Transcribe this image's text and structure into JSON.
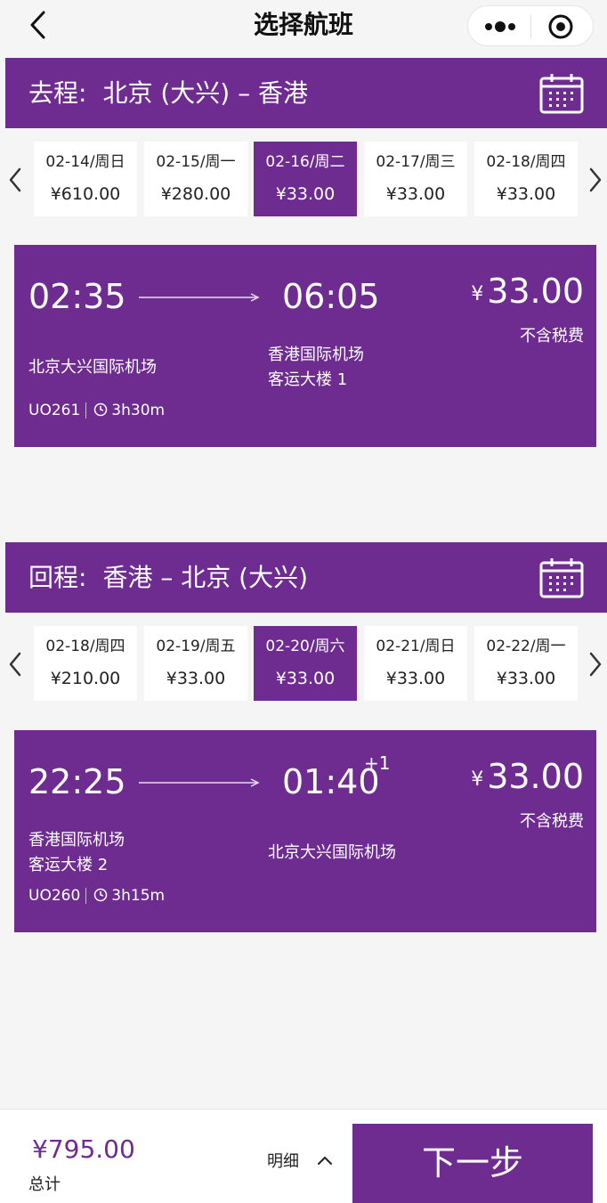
{
  "nav": {
    "title": "选择航班"
  },
  "outbound": {
    "prefix": "去程:",
    "route": "北京 (大兴) – 香港",
    "dates": [
      {
        "date": "02-14/周日",
        "price": "¥610.00",
        "selected": false
      },
      {
        "date": "02-15/周一",
        "price": "¥280.00",
        "selected": false
      },
      {
        "date": "02-16/周二",
        "price": "¥33.00",
        "selected": true
      },
      {
        "date": "02-17/周三",
        "price": "¥33.00",
        "selected": false
      },
      {
        "date": "02-18/周四",
        "price": "¥33.00",
        "selected": false
      }
    ],
    "flight": {
      "dep_time": "02:35",
      "arr_time": "06:05",
      "currency": "¥",
      "price": "33.00",
      "tax_note": "不含税费",
      "dep_airport": "北京大兴国际机场",
      "arr_airport": "香港国际机场",
      "arr_terminal": "客运大楼 1",
      "flight_no": "UO261",
      "duration": "3h30m"
    }
  },
  "return": {
    "prefix": "回程:",
    "route": "香港 – 北京 (大兴)",
    "dates": [
      {
        "date": "02-18/周四",
        "price": "¥210.00",
        "selected": false
      },
      {
        "date": "02-19/周五",
        "price": "¥33.00",
        "selected": false
      },
      {
        "date": "02-20/周六",
        "price": "¥33.00",
        "selected": true
      },
      {
        "date": "02-21/周日",
        "price": "¥33.00",
        "selected": false
      },
      {
        "date": "02-22/周一",
        "price": "¥33.00",
        "selected": false
      }
    ],
    "flight": {
      "dep_time": "22:25",
      "arr_time": "01:40",
      "day_offset": "+1",
      "currency": "¥",
      "price": "33.00",
      "tax_note": "不含税费",
      "dep_airport": "香港国际机场",
      "dep_terminal": "客运大楼 2",
      "arr_airport": "北京大兴国际机场",
      "flight_no": "UO260",
      "duration": "3h15m"
    }
  },
  "footer": {
    "total_price": "¥795.00",
    "total_label": "总计",
    "detail_label": "明细",
    "next_label": "下一步"
  },
  "colors": {
    "brand": "#6e2c91",
    "background": "#f4f5f4"
  }
}
